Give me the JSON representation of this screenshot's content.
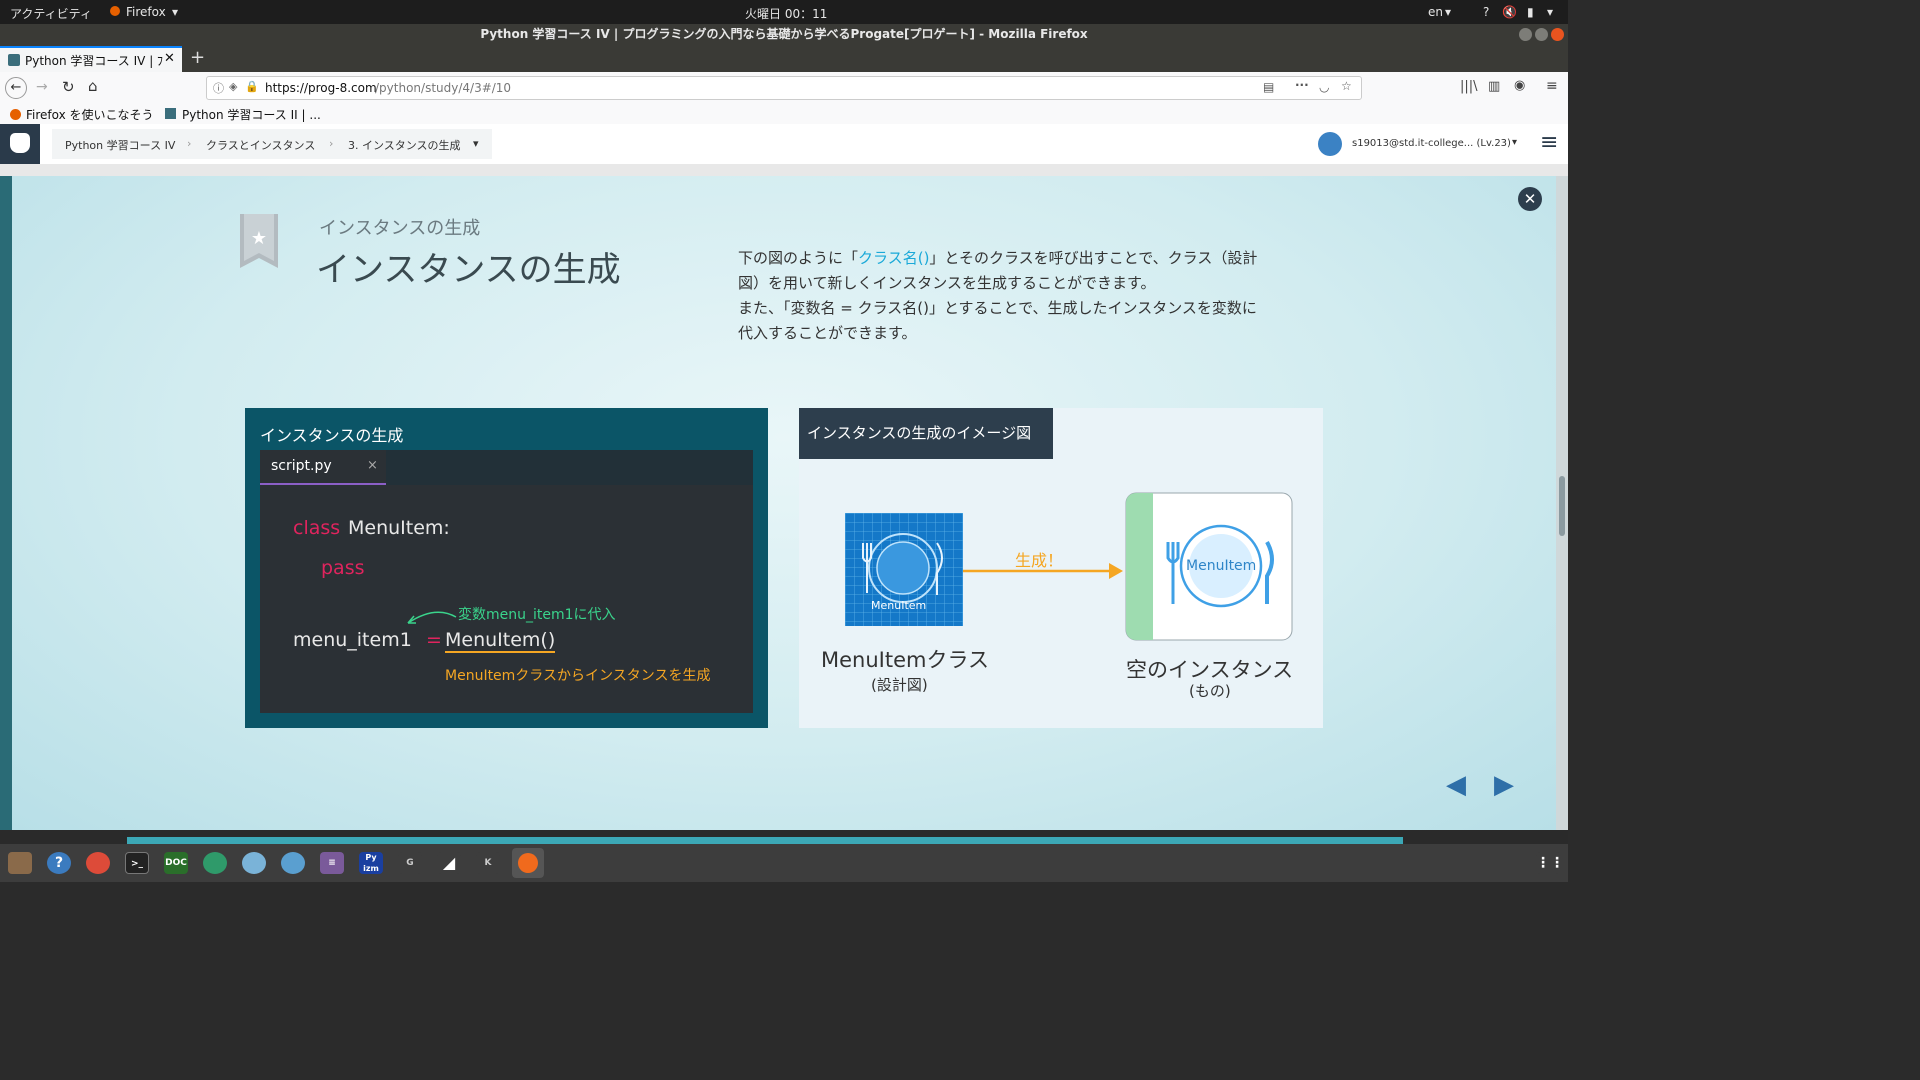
{
  "gnome": {
    "activities": "アクティビティ",
    "app_name": "Firefox",
    "clock": "火曜日 00：11",
    "lang": "en"
  },
  "window": {
    "title": "Python 学習コース IV | プログラミングの入門なら基礎から学べるProgate[プロゲート] - Mozilla Firefox"
  },
  "tabs": [
    {
      "label": "Python 学習コース IV | ﾌﾞ"
    }
  ],
  "navbar": {
    "url_host": "https://prog-8.com",
    "url_path": "/python/study/4/3#/10"
  },
  "bookmarks": [
    {
      "label": "Firefox を使いこなそう"
    },
    {
      "label": "Python 学習コース II | ..."
    }
  ],
  "header": {
    "breadcrumbs": [
      "Python 学習コース IV",
      "クラスとインスタンス",
      "3. インスタンスの生成"
    ],
    "user": "s19013@std.it-college... (Lv.23)"
  },
  "slide": {
    "subtitle": "インスタンスの生成",
    "title": "インスタンスの生成",
    "desc1_pre": "下の図のように「",
    "desc1_link": "クラス名()",
    "desc1_post": "」とそのクラスを呼び出すことで、クラス（設計",
    "desc2": "図）を用いて新しくインスタンスを生成することができます。",
    "desc3": "また、「変数名 = クラス名()」とすることで、生成したインスタンスを変数に",
    "desc4": "代入することができます。",
    "code_panel_title": "インスタンスの生成",
    "file_tab": "script.py",
    "file_close": "×",
    "code_kw_class": "class",
    "code_classname": "MenuItem:",
    "code_kw_pass": "pass",
    "code_var": "menu_item1",
    "code_eq": "=",
    "code_call": "MenuItem()",
    "annot_assign": "変数menu_item1に代入",
    "annot_create": "MenuItemクラスからインスタンスを生成",
    "image_panel_title": "インスタンスの生成のイメージ図",
    "blueprint_label": "MenuItem",
    "arrow_label": "生成！",
    "instance_label": "MenuItem",
    "class_caption": "MenuItemクラス",
    "class_sub": "(設計図)",
    "instance_caption": "空のインスタンス",
    "instance_sub": "(もの)"
  },
  "taskbar": {
    "doc": "DOC",
    "pyizm": "Py izm",
    "g": "G",
    "k": "K"
  },
  "colors": {
    "accent_teal": "#0b5567",
    "code_red": "#e0245e",
    "link": "#1aa9d8",
    "annot_green": "#3ad48c",
    "annot_orange": "#f5a623"
  }
}
